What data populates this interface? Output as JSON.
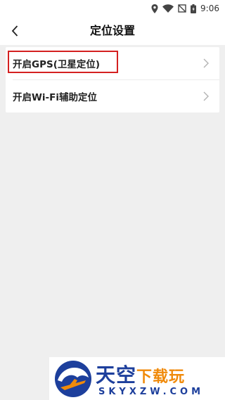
{
  "status_bar": {
    "time": "9:06",
    "icons": [
      "location-icon",
      "wifi-icon",
      "no-sim-icon",
      "battery-icon"
    ]
  },
  "header": {
    "title": "定位设置",
    "back_icon": "back-arrow-icon"
  },
  "settings": {
    "items": [
      {
        "label": "开启GPS(卫星定位)",
        "icon": "chevron-right-icon",
        "highlighted": true
      },
      {
        "label": "开启Wi-Fi辅助定位",
        "icon": "chevron-right-icon",
        "highlighted": false
      }
    ]
  },
  "watermark": {
    "brand_main": "天空",
    "brand_accent": "下载玩",
    "domain": "SKYXZW.COM"
  },
  "colors": {
    "background": "#efefef",
    "highlight": "#d42020",
    "watermark_blue": "#1d3f9c",
    "watermark_orange": "#f08a0a"
  }
}
